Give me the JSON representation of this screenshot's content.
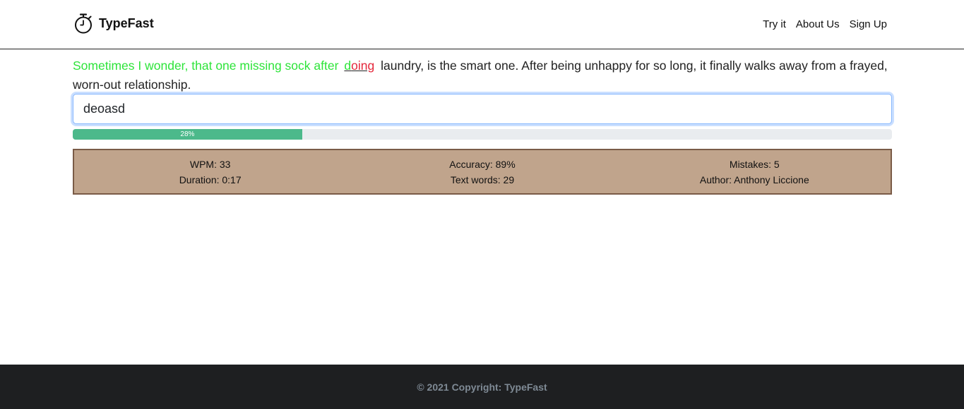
{
  "brand": {
    "name": "TypeFast",
    "icon": "stopwatch-icon"
  },
  "nav": {
    "items": [
      {
        "label": "Try it"
      },
      {
        "label": "About Us"
      },
      {
        "label": "Sign Up"
      }
    ]
  },
  "quote": {
    "typed": "Sometimes I wonder, that one missing sock after",
    "current_correct": "d",
    "current_error": "oing",
    "remaining": "laundry, is the smart one. After being unhappy for so long, it finally walks away from a frayed, worn-out relationship."
  },
  "input": {
    "value": "deoasd"
  },
  "progress": {
    "percent": 28,
    "label": "28%"
  },
  "stats": {
    "wpm": "WPM: 33",
    "duration": "Duration: 0:17",
    "accuracy": "Accuracy: 89%",
    "text_words": "Text words: 29",
    "mistakes": "Mistakes: 5",
    "author": "Author: Anthony Liccione"
  },
  "footer": {
    "text": "© 2021 Copyright: TypeFast"
  },
  "colors": {
    "typed": "#2ee43a",
    "error": "#e4263a",
    "progress": "#4cb98b",
    "stats_bg": "#c0a48c",
    "footer_bg": "#1e1f21"
  }
}
